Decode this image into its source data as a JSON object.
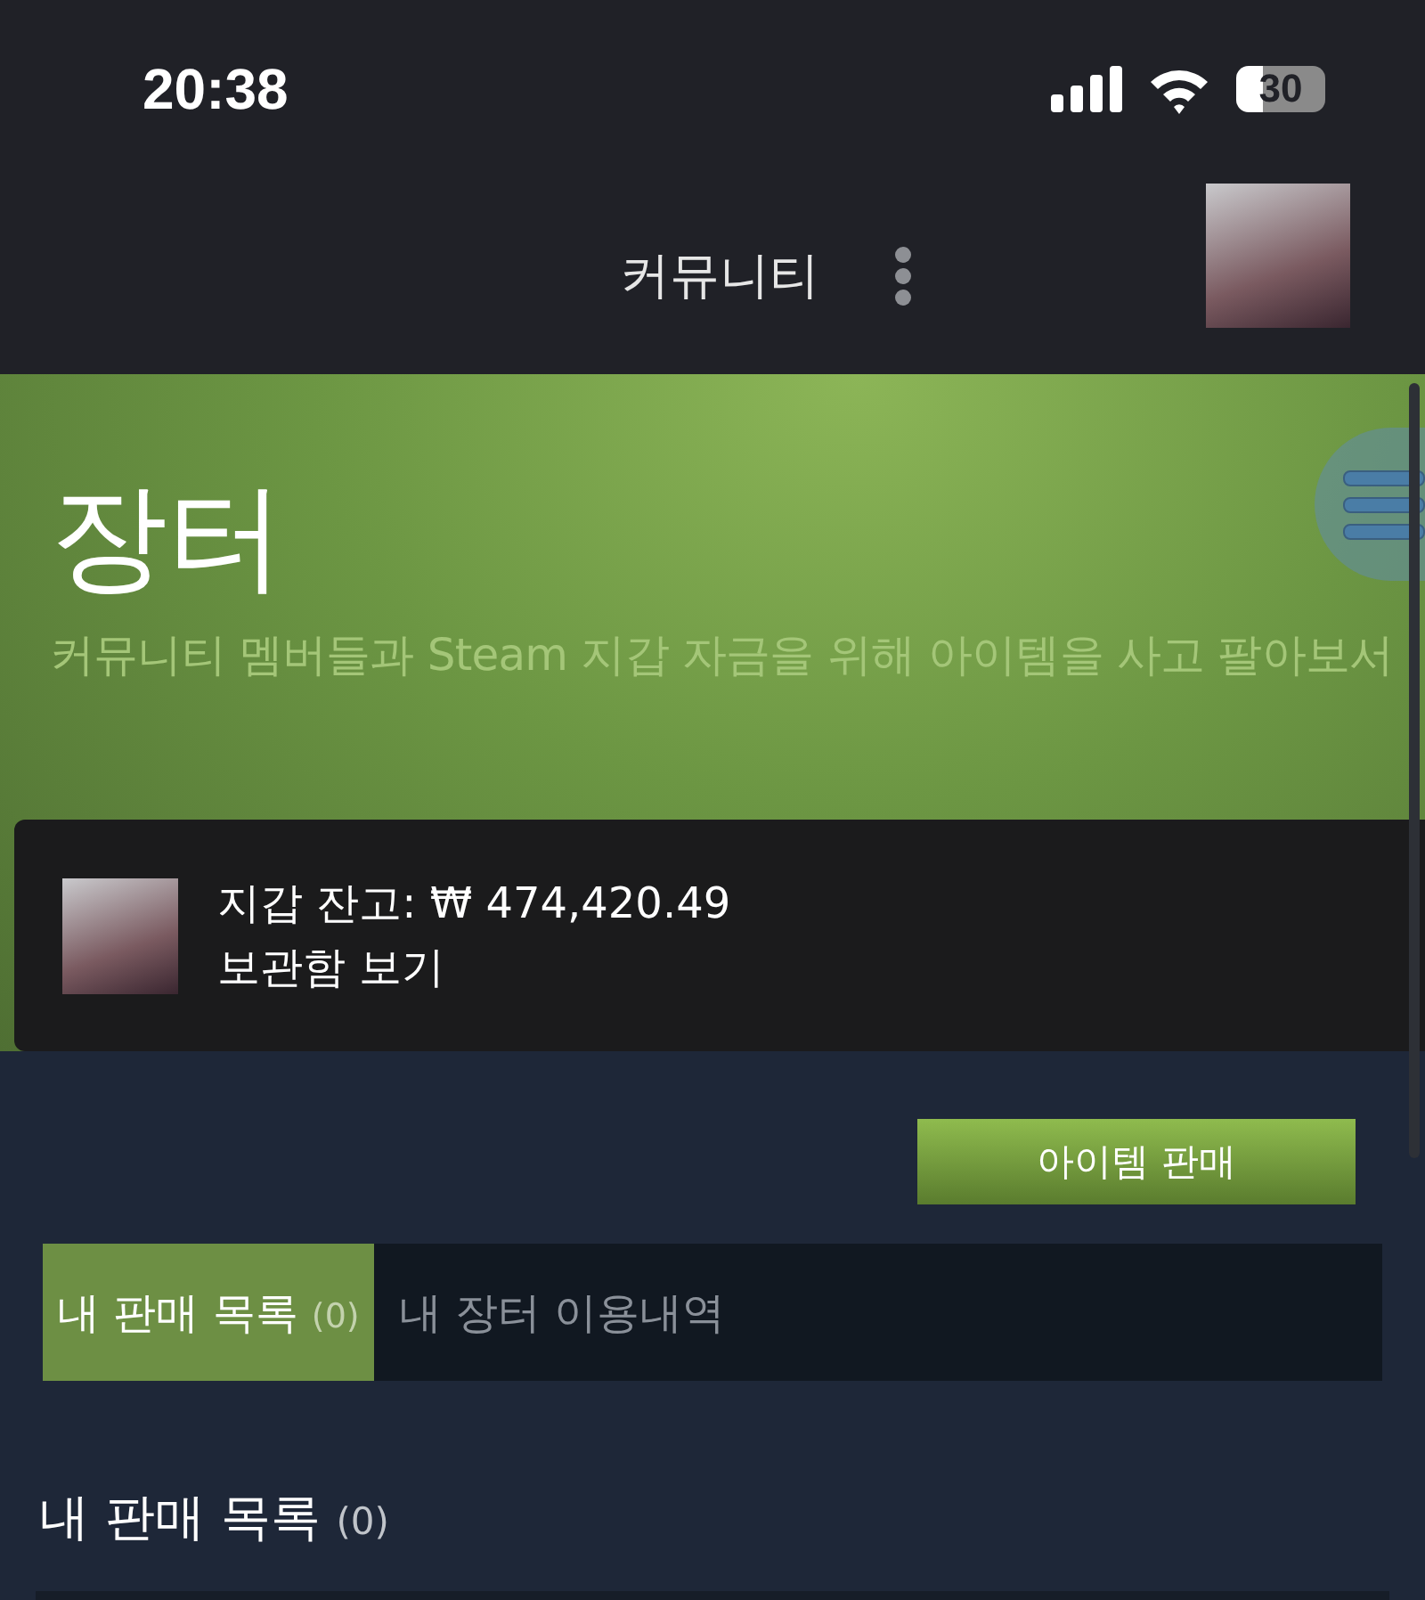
{
  "status_bar": {
    "time": "20:38",
    "battery": "30"
  },
  "header": {
    "title": "커뮤니티"
  },
  "banner": {
    "title": "장터",
    "subtitle": "커뮤니티 멤버들과 Steam 지갑 자금을 위해 아이템을 사고 팔아보서"
  },
  "wallet": {
    "balance": "지갑 잔고: ₩ 474,420.49",
    "inventory_link": "보관함 보기"
  },
  "sell_button": "아이템 판매",
  "tabs": [
    {
      "label": "내 판매 목록",
      "count": "(0)",
      "selected": true
    },
    {
      "label": "내 장터 이용내역",
      "selected": false
    }
  ],
  "section": {
    "title": "내 판매 목록",
    "count": "(0)"
  }
}
